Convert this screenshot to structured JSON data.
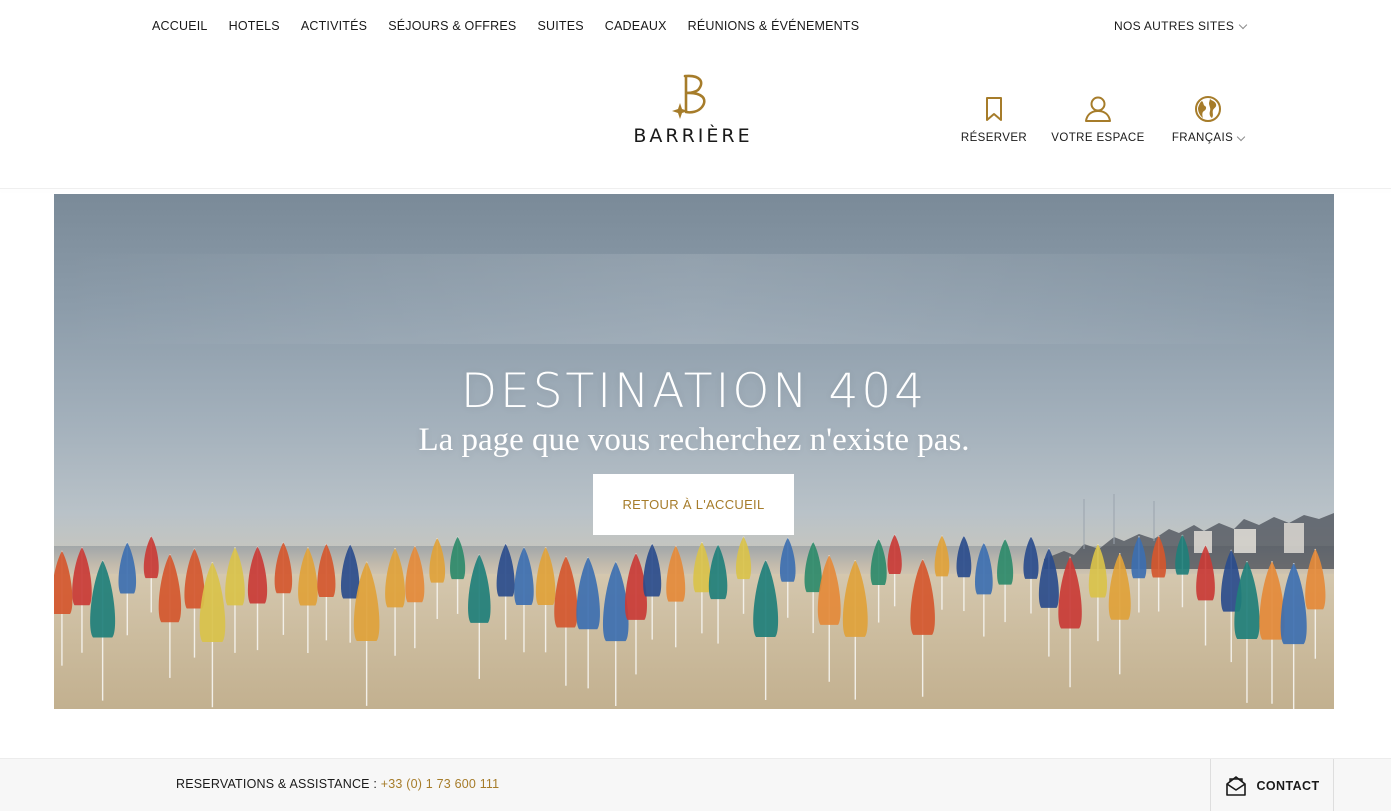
{
  "topnav": {
    "items": [
      {
        "label": "ACCUEIL"
      },
      {
        "label": "HOTELS"
      },
      {
        "label": "ACTIVITÉS"
      },
      {
        "label": "SÉJOURS & OFFRES"
      },
      {
        "label": "SUITES"
      },
      {
        "label": "CADEAUX"
      },
      {
        "label": "RÉUNIONS & ÉVÉNEMENTS"
      }
    ],
    "other_sites_label": "NOS AUTRES SITES"
  },
  "header": {
    "logo_text": "BARRIÈRE",
    "actions": {
      "reserver": {
        "label": "RÉSERVER",
        "icon": "bookmark-icon"
      },
      "espace": {
        "label": "VOTRE ESPACE",
        "icon": "user-icon"
      },
      "langue": {
        "label": "FRANÇAIS",
        "icon": "globe-icon"
      }
    }
  },
  "hero": {
    "title": "DESTINATION 404",
    "subtitle": "La page que vous recherchez n'existe pas.",
    "button_label": "RETOUR À L'ACCUEIL"
  },
  "footer": {
    "assistance_label": "RESERVATIONS & ASSISTANCE :",
    "phone": "+33 (0) 1 73 600 111",
    "contact_label": "CONTACT"
  },
  "colors": {
    "accent_gold": "#a67c2a",
    "text": "#1a1a1a",
    "footer_bg": "#f7f7f7"
  }
}
